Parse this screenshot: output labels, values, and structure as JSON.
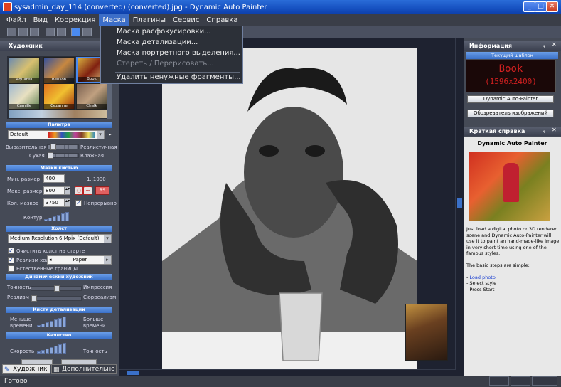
{
  "window": {
    "title": "sysadmin_day_114 (converted) (converted).jpg - Dynamic Auto Painter"
  },
  "menu": [
    "Файл",
    "Вид",
    "Коррекция",
    "Маска",
    "Плагины",
    "Сервис",
    "Справка"
  ],
  "mask_menu": {
    "items": [
      "Маска расфокусировки...",
      "Маска детализации...",
      "Маска портретного выделения...",
      "Стереть / Перерисовать...",
      "Удалить ненужные фрагменты..."
    ]
  },
  "artist_panel": {
    "title": "Художник",
    "styles": [
      "Aquarell",
      "Benson",
      "Book",
      "Camille",
      "Cezanne",
      "Chalk"
    ],
    "palette": {
      "header": "Палитра",
      "preset": "Default",
      "expressive": "Выразительная",
      "realistic": "Реалистичная",
      "dry": "Сухая",
      "wet": "Влажная"
    },
    "strokes": {
      "header": "Мазки кистью",
      "min_size_label": "Мин. размер",
      "min_size": "400",
      "range": "1..1000",
      "max_size_label": "Макс. размер",
      "max_size": "800",
      "rs": "RS",
      "count_label": "Кол. мазков",
      "count": "3750",
      "continuous": "Непрерывно",
      "contour": "Контур"
    },
    "canvas": {
      "header": "Холст",
      "resolution": "Medium Resolution 6 Mpix (Default)",
      "clear_on_start": "Очистить холст на старте",
      "canvas_realism": "Реализм холста",
      "paper": "Paper",
      "natural_borders": "Естественные границы"
    },
    "dynamic": {
      "header": "Динамический художник",
      "accuracy": "Точность",
      "impression": "Импрессия",
      "realism": "Реализм",
      "surrealism": "Сюрреализм"
    },
    "detail": {
      "header": "Кисти детализации",
      "less_time_1": "Меньше",
      "less_time_2": "времени",
      "more_time_1": "Больше",
      "more_time_2": "времени"
    },
    "quality": {
      "header": "Качество",
      "speed": "Скорость",
      "accuracy": "Точность"
    }
  },
  "bottom_tabs": [
    "Художник",
    "Дополнительно"
  ],
  "info_panel": {
    "title": "Информация",
    "current_template_label": "Текущий шаблон",
    "led_name": "Book",
    "led_size": "(1596x2400)",
    "dap_button": "Dynamic Auto-Painter",
    "browser_button": "Обозреватель изображений"
  },
  "help_panel": {
    "title": "Краткая справка",
    "heading": "Dynamic Auto Painter",
    "body_lines": [
      "Just load a digital photo or 3D rendered",
      "scene and Dynamic Auto-Painter will",
      "use it to paint an hand-made-like image",
      "in very short time using one of the",
      "famous styles."
    ],
    "steps_intro": "The basic steps are simple:",
    "step1_prefix": "- ",
    "step1_link": "Load photo",
    "step2": "- Select style",
    "step3": "- Press Start"
  },
  "status": {
    "text": "Готово"
  }
}
